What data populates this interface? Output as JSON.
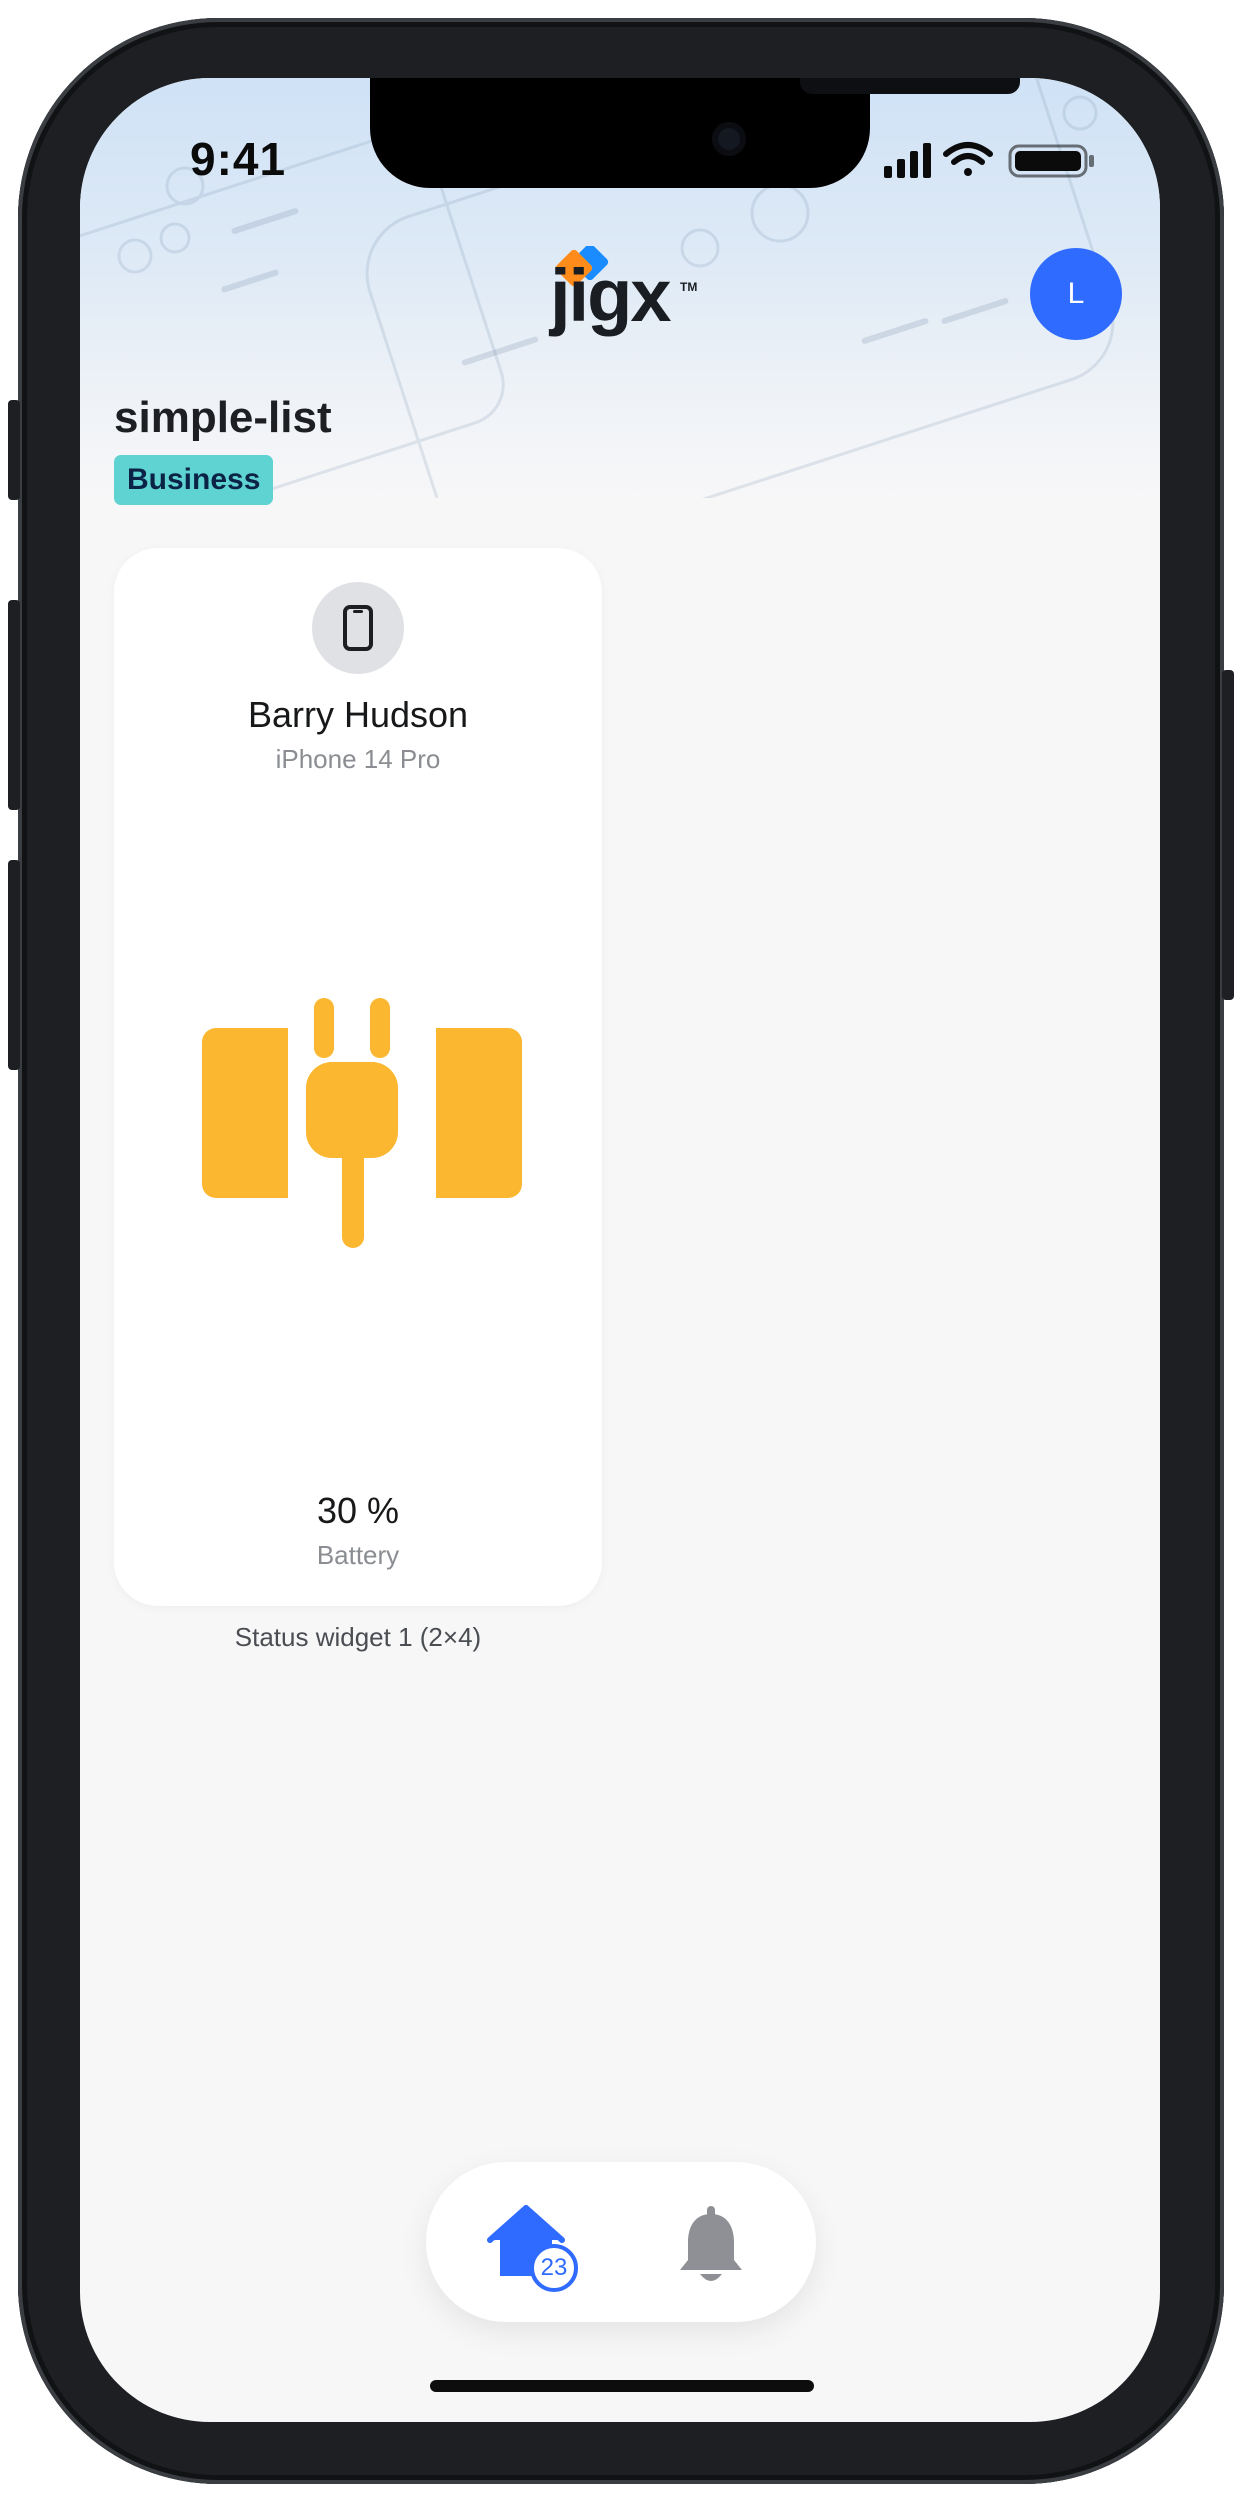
{
  "status_bar": {
    "time": "9:41"
  },
  "header": {
    "logo_text": "jigx",
    "logo_tm": "TM",
    "avatar_initial": "L"
  },
  "page": {
    "title": "simple-list",
    "badge": "Business"
  },
  "card": {
    "name": "Barry Hudson",
    "device": "iPhone 14 Pro",
    "value": "30 %",
    "value_label": "Battery",
    "battery_level": 0.3,
    "icon": "battery-charging-plug-icon",
    "icon_color": "#fbb72f"
  },
  "widget": {
    "caption": "Status widget 1 (2×4)"
  },
  "tabbar": {
    "home_badge": "23",
    "active_color": "#2f6bff",
    "inactive_color": "#8e9095"
  },
  "colors": {
    "accent": "#2f6bff",
    "badge_bg": "#5fd3d1"
  }
}
